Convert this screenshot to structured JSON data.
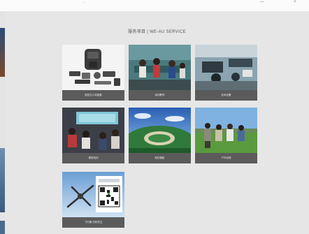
{
  "top_bar": {
    "caption": "...",
    "minimize_glyph": "—",
    "close_glyph": "×"
  },
  "section": {
    "title": "服务项目 | WE-AU SERVICE"
  },
  "cards": [
    {
      "caption": "航拍无人机装备"
    },
    {
      "caption": "培训教学"
    },
    {
      "caption": "技术设备"
    },
    {
      "caption": "课堂培训"
    },
    {
      "caption": "航拍摄影"
    },
    {
      "caption": "户外实践"
    },
    {
      "caption": "飞行器·扫码关注"
    }
  ]
}
